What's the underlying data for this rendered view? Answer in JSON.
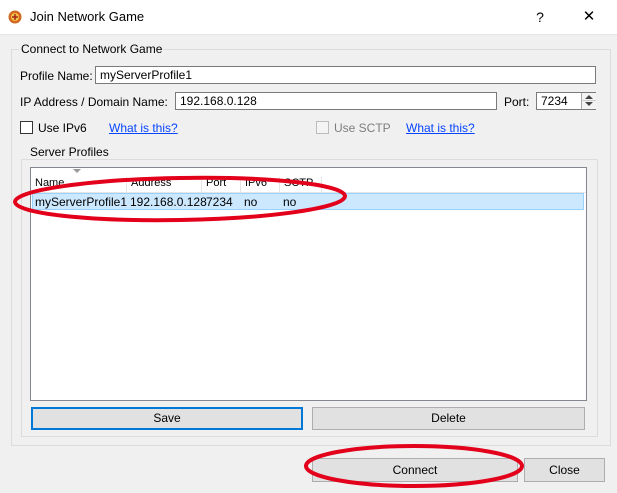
{
  "window": {
    "title": "Join Network Game",
    "help_glyph": "?",
    "close_glyph": "✕",
    "icon": "game-app-icon"
  },
  "connect_group": {
    "title": "Connect to Network Game",
    "profile_label": "Profile Name:",
    "profile_value": "myServerProfile1",
    "ip_label": "IP Address / Domain Name:",
    "ip_value": "192.168.0.128",
    "port_label": "Port:",
    "port_value": "7234",
    "ipv6_label": "Use IPv6",
    "ipv6_checked": false,
    "ipv6_link": "What is this?",
    "sctp_label": "Use SCTP",
    "sctp_checked": false,
    "sctp_enabled": false,
    "sctp_link": "What is this?"
  },
  "profiles_group": {
    "title": "Server Profiles",
    "columns": [
      "Name",
      "Address",
      "Port",
      "IPv6",
      "SCTP"
    ],
    "rows": [
      [
        "myServerProfile1",
        "192.168.0.128",
        "7234",
        "no",
        "no"
      ]
    ],
    "save_label": "Save",
    "delete_label": "Delete"
  },
  "footer": {
    "connect_label": "Connect",
    "close_label": "Close"
  },
  "colors": {
    "annotation_red": "#e3001b",
    "selection": "#cce8ff",
    "link": "#0645ff",
    "focus_border": "#0078d7"
  }
}
